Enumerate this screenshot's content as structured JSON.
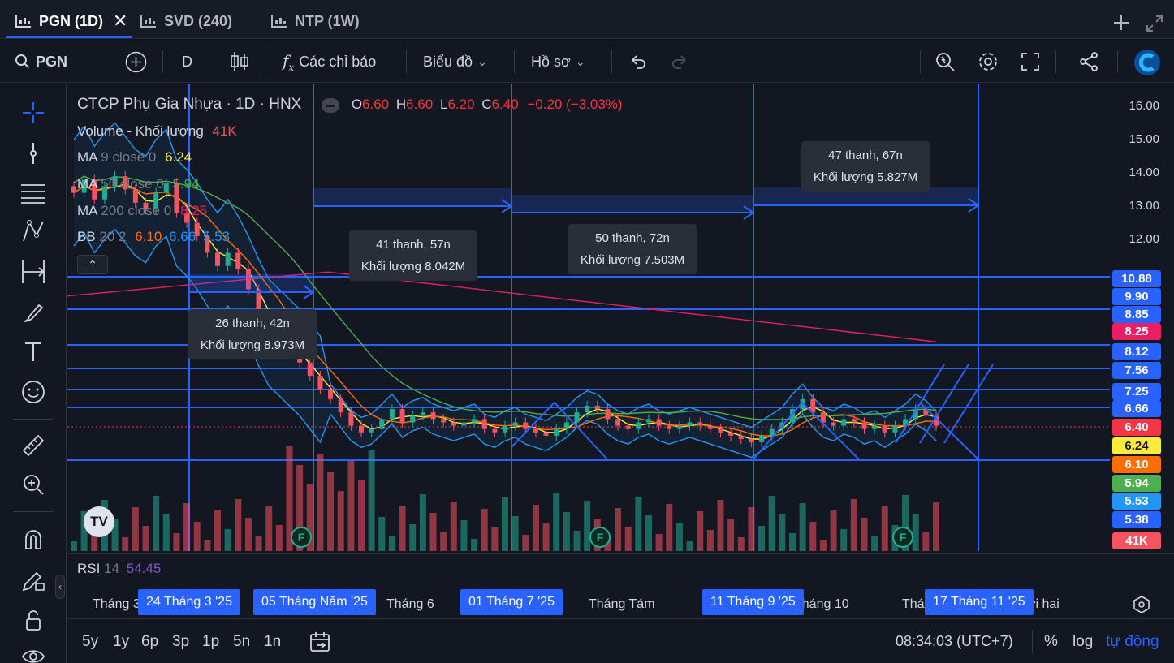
{
  "tabs": [
    {
      "label": "PGN (1D)",
      "active": true
    },
    {
      "label": "SVD (240)"
    },
    {
      "label": "NTP (1W)"
    }
  ],
  "toolbar": {
    "symbol": "PGN",
    "interval": "D",
    "indicators_label": "Các chỉ báo",
    "chart_type_label": "Biểu đồ",
    "profile_label": "Hồ sơ"
  },
  "legend": {
    "title": "CTCP Phụ Gia Nhựa · 1D · HNX",
    "o_label": "O",
    "o": "6.60",
    "h_label": "H",
    "h": "6.60",
    "l_label": "L",
    "l": "6.20",
    "c_label": "C",
    "c": "6.40",
    "change": "−0.20 (−3.03%)",
    "volume_label": "Volume - Khối lượng",
    "volume_value": "41K",
    "ma9_label": "MA",
    "ma9_params": "9 close 0",
    "ma9_value": "6.24",
    "ma50_label": "MA",
    "ma50_params": "50 close 0",
    "ma50_value": "5.94",
    "ma200_label": "MA",
    "ma200_params": "200 close 0",
    "ma200_value": "8.25",
    "bb_label": "BB",
    "bb_params": "20 2",
    "bb_v1": "6.10",
    "bb_v2": "6.66",
    "bb_v3": "5.53"
  },
  "price_axis": [
    "16.00",
    "15.00",
    "14.00",
    "13.00",
    "12.00"
  ],
  "price_badges": [
    {
      "text": "10.88",
      "color": "#2962ff"
    },
    {
      "text": "9.90",
      "color": "#2962ff"
    },
    {
      "text": "8.85",
      "color": "#2962ff"
    },
    {
      "text": "8.25",
      "color": "#e91e63"
    },
    {
      "text": "8.12",
      "color": "#2962ff"
    },
    {
      "text": "7.56",
      "color": "#2962ff"
    },
    {
      "text": "7.25",
      "color": "#2962ff"
    },
    {
      "text": "6.66",
      "color": "#2962ff"
    },
    {
      "text": "6.40",
      "color": "#f23645"
    },
    {
      "text": "6.24",
      "color": "#ffeb3b"
    },
    {
      "text": "6.10",
      "color": "#ff6d00"
    },
    {
      "text": "5.94",
      "color": "#4caf50"
    },
    {
      "text": "5.53",
      "color": "#2196f3"
    },
    {
      "text": "5.38",
      "color": "#2962ff"
    },
    {
      "text": "41K",
      "color": "#f7525f"
    }
  ],
  "annotations": [
    {
      "line1": "26 thanh, 42n",
      "line2": "Khối lượng 8.973M"
    },
    {
      "line1": "41 thanh, 57n",
      "line2": "Khối lượng 8.042M"
    },
    {
      "line1": "50 thanh, 72n",
      "line2": "Khối lượng 7.503M"
    },
    {
      "line1": "47 thanh, 67n",
      "line2": "Khối lượng 5.827M"
    }
  ],
  "rsi": {
    "label": "RSI",
    "params": "14",
    "value": "54.45"
  },
  "time_axis": {
    "labels": [
      "Tháng 3",
      "Tháng 6",
      "Tháng Tám",
      "Tháng 10",
      "Thá",
      "ời hai"
    ],
    "badges": [
      "24 Tháng 3 '25",
      "05 Tháng Năm '25",
      "01 Tháng 7 '25",
      "11 Tháng 9 '25",
      "17 Tháng 11 '25"
    ]
  },
  "bottom": {
    "ranges": [
      "5y",
      "1y",
      "6p",
      "3p",
      "1p",
      "5n",
      "1n"
    ],
    "clock": "08:34:03 (UTC+7)",
    "percent": "%",
    "log": "log",
    "auto": "tự động"
  },
  "events_label": "F",
  "tv_logo": "TV",
  "chart_data": {
    "type": "candlestick",
    "title": "CTCP Phụ Gia Nhựa · 1D · HNX",
    "ylim": [
      5.2,
      16.3
    ],
    "price_ticks": [
      16,
      15,
      14,
      13,
      12
    ],
    "close_series": [
      13.4,
      13.8,
      13.2,
      13.6,
      13.9,
      13.5,
      13.1,
      12.9,
      13.4,
      13.7,
      12.8,
      12.5,
      12.1,
      11.6,
      11.2,
      11.6,
      11.1,
      10.5,
      9.8,
      9.2,
      8.9,
      8.6,
      8.3,
      7.9,
      7.5,
      7.2,
      6.8,
      6.4,
      6.2,
      6.3,
      6.6,
      6.9,
      6.5,
      6.7,
      6.8,
      6.6,
      6.5,
      6.4,
      6.5,
      6.6,
      6.3,
      6.2,
      6.4,
      6.5,
      6.3,
      6.2,
      6.1,
      6.3,
      6.5,
      6.8,
      7.0,
      6.9,
      6.6,
      6.4,
      6.3,
      6.5,
      6.6,
      6.4,
      6.3,
      6.4,
      6.5,
      6.4,
      6.3,
      6.2,
      6.1,
      6.0,
      5.9,
      6.1,
      6.3,
      6.5,
      6.9,
      7.2,
      6.8,
      6.5,
      6.4,
      6.6,
      6.5,
      6.3,
      6.4,
      6.2,
      6.4,
      6.6,
      6.9,
      6.7,
      6.4
    ],
    "h_levels": [
      10.88,
      9.9,
      8.85,
      8.12,
      7.56,
      7.25,
      6.66,
      6.4,
      6.1,
      5.38
    ],
    "ma9_last": 6.24,
    "ma50_last": 5.94,
    "ma200_last": 8.25,
    "bb_upper": 6.66,
    "bb_mid": 6.1,
    "bb_lower": 5.53,
    "volume_last": "41K"
  }
}
